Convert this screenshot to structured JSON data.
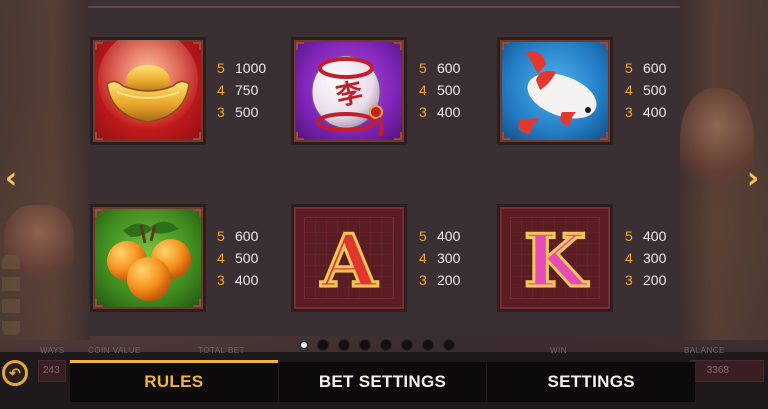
{
  "paytable": {
    "symbols": [
      {
        "id": "ingot",
        "name": "gold-ingot",
        "pays": [
          {
            "count": "5",
            "value": "1000"
          },
          {
            "count": "4",
            "value": "750"
          },
          {
            "count": "3",
            "value": "500"
          }
        ]
      },
      {
        "id": "vase",
        "name": "lucky-vase",
        "pays": [
          {
            "count": "5",
            "value": "600"
          },
          {
            "count": "4",
            "value": "500"
          },
          {
            "count": "3",
            "value": "400"
          }
        ]
      },
      {
        "id": "koi",
        "name": "koi-fish",
        "pays": [
          {
            "count": "5",
            "value": "600"
          },
          {
            "count": "4",
            "value": "500"
          },
          {
            "count": "3",
            "value": "400"
          }
        ]
      },
      {
        "id": "orange",
        "name": "oranges",
        "pays": [
          {
            "count": "5",
            "value": "600"
          },
          {
            "count": "4",
            "value": "500"
          },
          {
            "count": "3",
            "value": "400"
          }
        ]
      },
      {
        "id": "a",
        "name": "letter-a",
        "letter": "A",
        "pays": [
          {
            "count": "5",
            "value": "400"
          },
          {
            "count": "4",
            "value": "300"
          },
          {
            "count": "3",
            "value": "200"
          }
        ]
      },
      {
        "id": "k",
        "name": "letter-k",
        "letter": "K",
        "pays": [
          {
            "count": "5",
            "value": "400"
          },
          {
            "count": "4",
            "value": "300"
          },
          {
            "count": "3",
            "value": "200"
          }
        ]
      }
    ],
    "vase_glyph": "李"
  },
  "navigation": {
    "prev_icon": "chevron-left-icon",
    "next_icon": "chevron-right-icon",
    "prev_glyph": "‹",
    "next_glyph": "›",
    "page_count": 8,
    "active_page": 0
  },
  "game_bar": {
    "ways_label": "WAYS",
    "ways_value": "243",
    "coin_value_label": "COIN VALUE",
    "total_bet_label": "TOTAL BET",
    "win_label": "WIN",
    "balance_label": "BALANCE",
    "balance_value": "3368"
  },
  "back_button": {
    "icon": "back-arrow-icon",
    "glyph": "↶"
  },
  "tabs": [
    {
      "label": "RULES",
      "active": true
    },
    {
      "label": "BET SETTINGS",
      "active": false
    },
    {
      "label": "SETTINGS",
      "active": false
    }
  ],
  "colors": {
    "accent": "#f2b441",
    "pay_count": "#f3a531",
    "pay_value": "#f2ece6"
  }
}
